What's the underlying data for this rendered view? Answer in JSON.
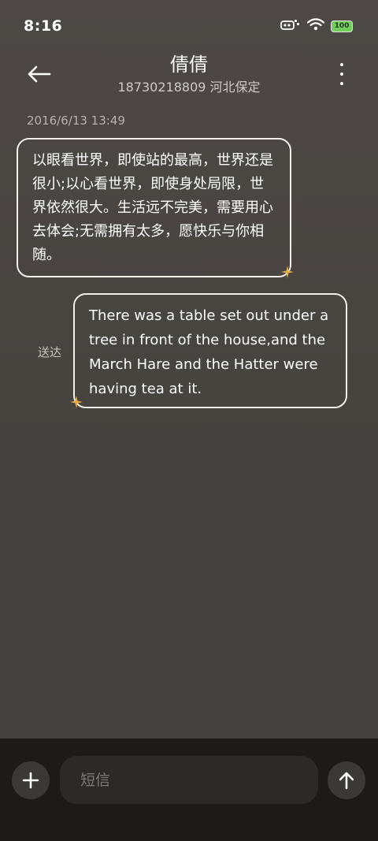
{
  "status_bar": {
    "time": "8:16",
    "battery": "100"
  },
  "header": {
    "contact_name": "倩倩",
    "subtitle": "18730218809 河北保定"
  },
  "conversation": {
    "timestamp": "2016/6/13 13:49",
    "incoming_message": "以眼看世界，即使站的最高，世界还是很小;以心看世界，即使身处局限，世界依然很大。生活远不完美，需要用心去体会;无需拥有太多，愿快乐与你相随。",
    "outgoing_message": "There was a table set out under a tree in front of the house,and the March Hare and the Hatter were having tea at it.",
    "sent_status": "送达"
  },
  "composer": {
    "placeholder": "短信"
  },
  "colors": {
    "background": "#4a4643",
    "bubble_border": "#f2eee8",
    "sparkle": "#e8a94a",
    "battery": "#6fcf5a",
    "bottom_bar": "#1d1b1a"
  },
  "icons": {
    "back": "arrow-left-icon",
    "more": "more-vertical-icon",
    "add": "plus-icon",
    "send": "arrow-up-icon",
    "signal": "signal-icon",
    "wifi": "wifi-icon",
    "battery": "battery-icon",
    "sparkle": "sparkle-icon"
  }
}
